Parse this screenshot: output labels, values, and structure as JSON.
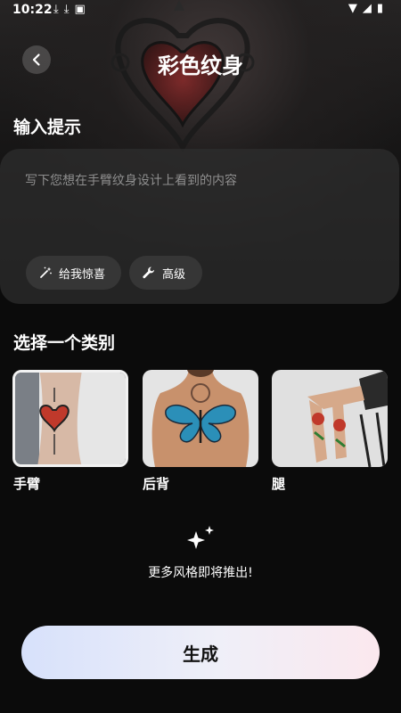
{
  "status_bar": {
    "time": "10:22"
  },
  "header": {
    "title": "彩色纹身"
  },
  "prompt_section": {
    "title": "输入提示",
    "placeholder": "写下您想在手臂纹身设计上看到的内容",
    "chips": [
      {
        "label": "给我惊喜",
        "icon": "magic-wand-icon"
      },
      {
        "label": "高级",
        "icon": "wrench-icon"
      }
    ]
  },
  "category_section": {
    "title": "选择一个类别",
    "items": [
      {
        "label": "手臂",
        "selected": true
      },
      {
        "label": "后背",
        "selected": false
      },
      {
        "label": "腿",
        "selected": false
      }
    ]
  },
  "coming_soon": {
    "text": "更多风格即将推出!"
  },
  "generate_button": {
    "label": "生成"
  }
}
